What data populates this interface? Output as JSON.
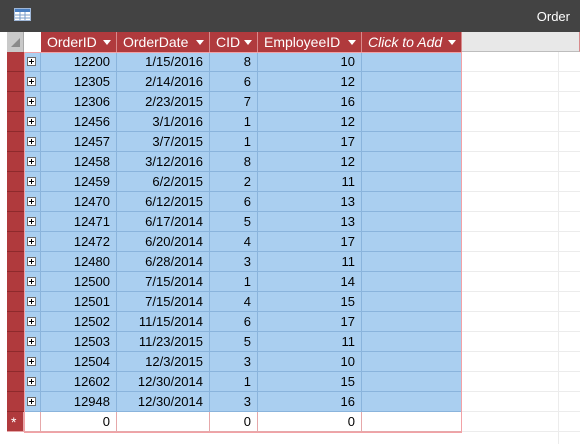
{
  "window": {
    "title": "Order",
    "icon": "datasheet-icon"
  },
  "table": {
    "columns": [
      "OrderID",
      "OrderDate",
      "CID",
      "EmployeeID"
    ],
    "add_column_label": "Click to Add",
    "rows": [
      [
        "12200",
        "1/15/2016",
        "8",
        "10"
      ],
      [
        "12305",
        "2/14/2016",
        "6",
        "12"
      ],
      [
        "12306",
        "2/23/2015",
        "7",
        "16"
      ],
      [
        "12456",
        "3/1/2016",
        "1",
        "12"
      ],
      [
        "12457",
        "3/7/2015",
        "1",
        "17"
      ],
      [
        "12458",
        "3/12/2016",
        "8",
        "12"
      ],
      [
        "12459",
        "6/2/2015",
        "2",
        "11"
      ],
      [
        "12470",
        "6/12/2015",
        "6",
        "13"
      ],
      [
        "12471",
        "6/17/2014",
        "5",
        "13"
      ],
      [
        "12472",
        "6/20/2014",
        "4",
        "17"
      ],
      [
        "12480",
        "6/28/2014",
        "3",
        "11"
      ],
      [
        "12500",
        "7/15/2014",
        "1",
        "14"
      ],
      [
        "12501",
        "7/15/2014",
        "4",
        "15"
      ],
      [
        "12502",
        "11/15/2014",
        "6",
        "17"
      ],
      [
        "12503",
        "11/23/2015",
        "5",
        "11"
      ],
      [
        "12504",
        "12/3/2015",
        "3",
        "10"
      ],
      [
        "12602",
        "12/30/2014",
        "1",
        "15"
      ],
      [
        "12948",
        "12/30/2014",
        "3",
        "16"
      ]
    ],
    "new_row": {
      "marker": "*",
      "values": [
        "0",
        "",
        "0",
        "0"
      ]
    }
  },
  "colors": {
    "header": "#b03a3d",
    "selected_cell": "#aacff0",
    "titlebar": "#434343"
  }
}
